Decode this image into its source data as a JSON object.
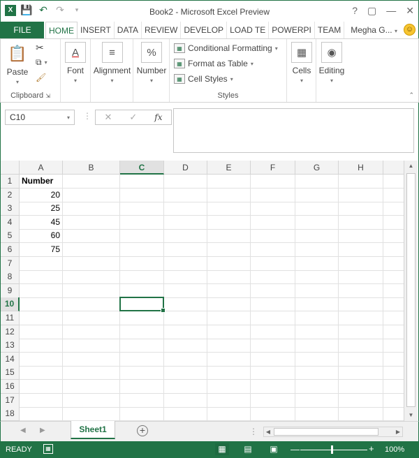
{
  "window": {
    "title": "Book2 - Microsoft Excel Preview",
    "help_label": "?",
    "user": "Megha G...",
    "accent": "#217346"
  },
  "ribbon_tabs": {
    "file": "FILE",
    "items": [
      "HOME",
      "INSERT",
      "DATA",
      "REVIEW",
      "DEVELOP",
      "LOAD TE",
      "POWERPI",
      "TEAM"
    ]
  },
  "ribbon": {
    "clipboard": {
      "paste": "Paste",
      "label": "Clipboard"
    },
    "font": {
      "label": "Font"
    },
    "alignment": {
      "label": "Alignment"
    },
    "number": {
      "label": "Number",
      "icon_text": "%"
    },
    "styles": {
      "conditional": "Conditional Formatting",
      "table": "Format as Table",
      "cell_styles": "Cell Styles",
      "label": "Styles"
    },
    "cells": {
      "label": "Cells"
    },
    "editing": {
      "label": "Editing"
    }
  },
  "formula_bar": {
    "name_box": "C10",
    "fx": "fx",
    "content": ""
  },
  "sheet": {
    "columns": [
      "A",
      "B",
      "C",
      "D",
      "E",
      "F",
      "G",
      "H"
    ],
    "selected_column": "C",
    "rows": [
      "1",
      "2",
      "3",
      "4",
      "5",
      "6",
      "7",
      "8",
      "9",
      "10",
      "11",
      "12",
      "13",
      "14",
      "15",
      "16",
      "17",
      "18"
    ],
    "selected_row": "10",
    "cells": [
      {
        "ref": "A1",
        "value": "Number",
        "bold": true
      },
      {
        "ref": "A2",
        "value": "20",
        "numeric": true
      },
      {
        "ref": "A3",
        "value": "25",
        "numeric": true
      },
      {
        "ref": "A4",
        "value": "45",
        "numeric": true
      },
      {
        "ref": "A5",
        "value": "60",
        "numeric": true
      },
      {
        "ref": "A6",
        "value": "75",
        "numeric": true
      }
    ],
    "active_cell": "C10"
  },
  "sheet_tabs": {
    "active": "Sheet1"
  },
  "status": {
    "text": "READY",
    "zoom": "100%"
  }
}
